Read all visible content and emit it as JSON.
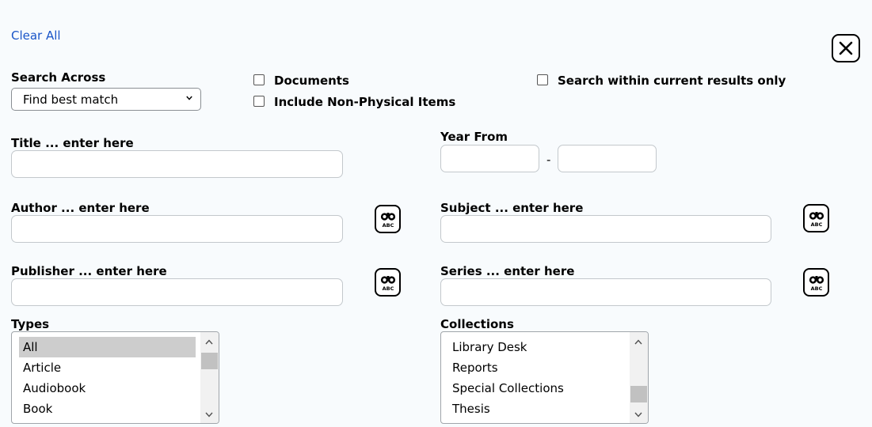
{
  "clear_all": "Clear All",
  "search_across": {
    "label": "Search Across",
    "selected": "Find best match"
  },
  "checkboxes": {
    "documents": "Documents",
    "non_physical": "Include Non-Physical Items",
    "within_results": "Search within current results only"
  },
  "fields": {
    "title": {
      "label": "Title ... enter here",
      "value": ""
    },
    "year": {
      "label": "Year From",
      "separator": "-",
      "from": "",
      "to": ""
    },
    "author": {
      "label": "Author ... enter here",
      "value": ""
    },
    "subject": {
      "label": "Subject ... enter here",
      "value": ""
    },
    "publisher": {
      "label": "Publisher ... enter here",
      "value": ""
    },
    "series": {
      "label": "Series ... enter here",
      "value": ""
    }
  },
  "browse_icon_text": "ABC",
  "types": {
    "label": "Types",
    "items": [
      "All",
      "Article",
      "Audiobook",
      "Book"
    ],
    "selected": "All"
  },
  "collections": {
    "label": "Collections",
    "items": [
      "Library Desk",
      "Reports",
      "Special Collections",
      "Thesis"
    ]
  }
}
